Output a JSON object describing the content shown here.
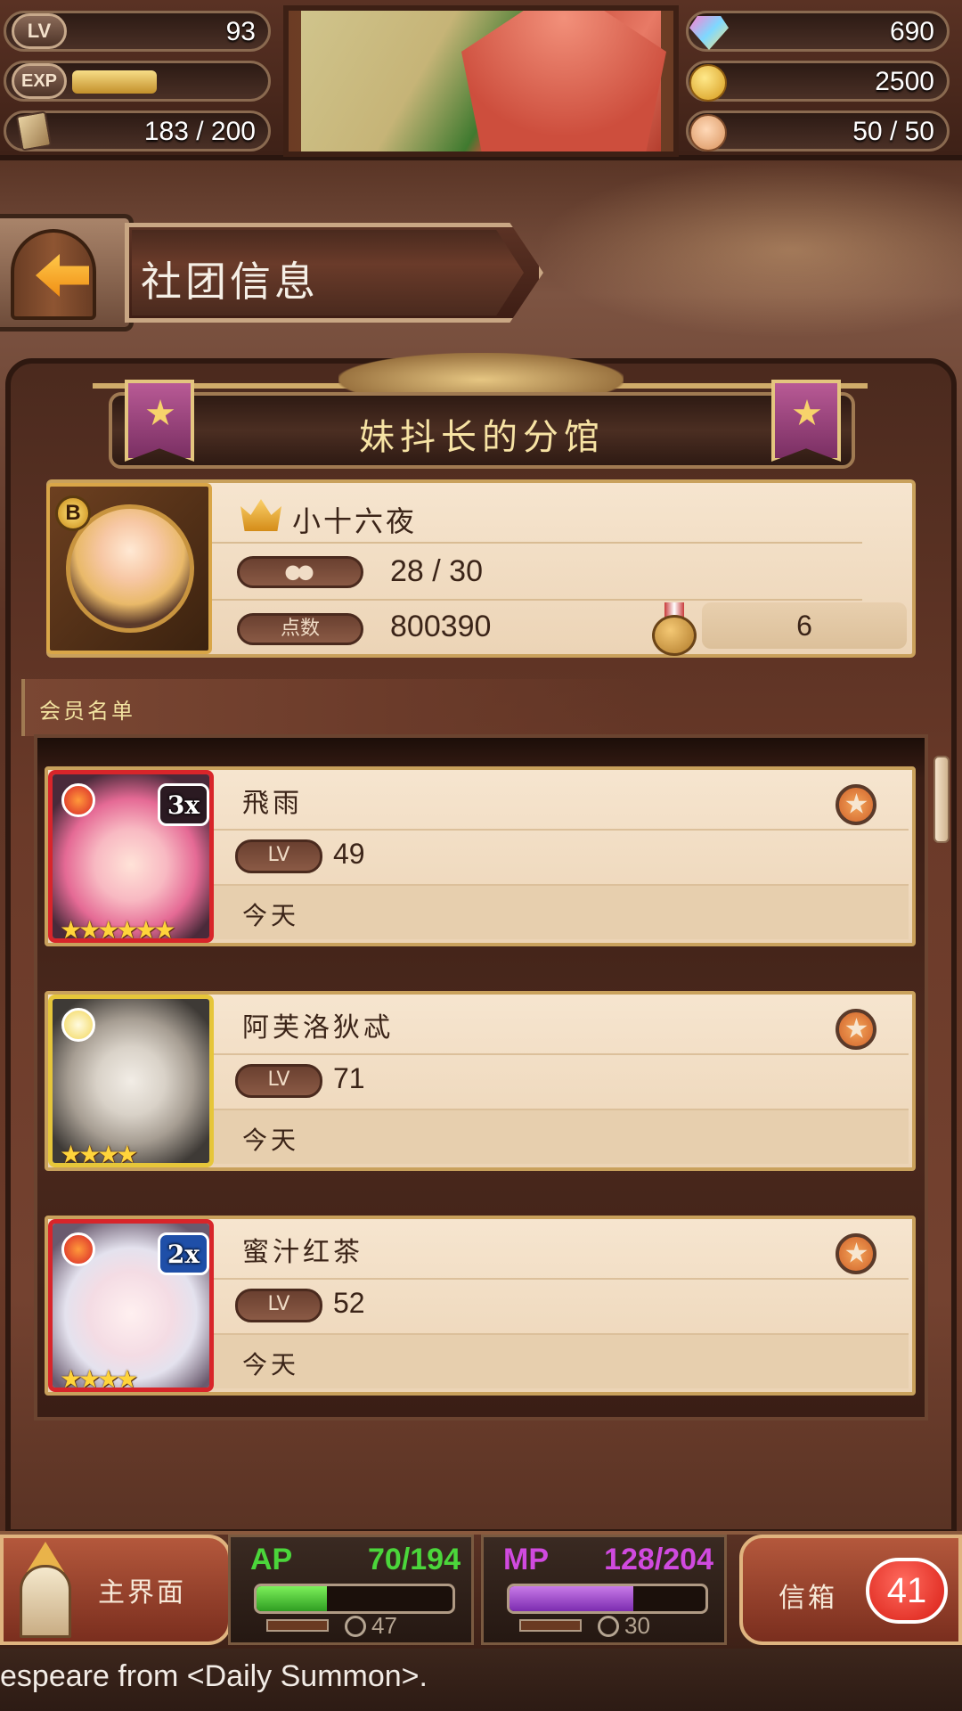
{
  "hud": {
    "lv_badge": "LV",
    "lv_value": "93",
    "exp_badge": "EXP",
    "exp_fraction": 0.45,
    "cards_value": "183  /  200",
    "gems_value": "690",
    "gold_value": "2500",
    "friends_value": "50  /  50"
  },
  "header": {
    "title": "社团信息"
  },
  "guild": {
    "name": "妹抖长的分馆",
    "rank_badge": "B",
    "leader": "小十六夜",
    "members": "28 / 30",
    "points_label": "点数",
    "points": "800390",
    "rank": "6"
  },
  "member_list": {
    "section_title": "会员名单",
    "lv_label": "LV",
    "members": [
      {
        "name": "飛雨",
        "level": "49",
        "last_login": "今天",
        "multiplier": "3x",
        "stars": "★★★★★★",
        "element": "fire"
      },
      {
        "name": "阿芙洛狄忒",
        "level": "71",
        "last_login": "今天",
        "multiplier": "",
        "stars": "★★★★",
        "element": "light"
      },
      {
        "name": "蜜汁红茶",
        "level": "52",
        "last_login": "今天",
        "multiplier": "2x",
        "stars": "★★★★",
        "element": "fire"
      }
    ]
  },
  "bottom_bar": {
    "home_label": "主界面",
    "ap_label": "AP",
    "ap_value": "70/194",
    "ap_fraction": 0.36,
    "ap_timer": "47",
    "mp_label": "MP",
    "mp_value": "128/204",
    "mp_fraction": 0.63,
    "mp_timer": "30",
    "mail_label": "信箱",
    "mail_count": "41"
  },
  "ticker": {
    "text": "espeare from <Daily Summon>."
  },
  "colors": {
    "ap_green": "#4bd63b",
    "mp_purple": "#d04adf",
    "panel_brown": "#6b3a29",
    "card_cream": "#f6e5cf"
  }
}
